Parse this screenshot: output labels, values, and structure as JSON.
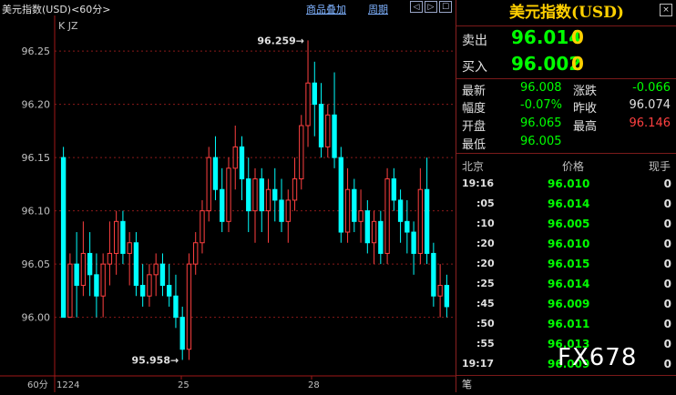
{
  "header": {
    "title": "美元指数(USD)<60分>",
    "links": [
      "商品叠加",
      "周期"
    ],
    "nav_buttons": [
      "◁",
      "▷",
      "☐"
    ]
  },
  "chart_data": {
    "type": "candlestick",
    "indicator_label": "K JZ",
    "period_label": "60分",
    "ylim": [
      95.945,
      96.28
    ],
    "y_ticks": [
      "96.25",
      "96.20",
      "96.15",
      "96.10",
      "96.05",
      "96.00"
    ],
    "x_ticks": [
      "1224",
      "25",
      "28"
    ],
    "annotations": {
      "high": "96.259",
      "low": "95.958"
    },
    "colors": {
      "up": "#ff4040",
      "down": "#00ffff"
    },
    "candles": [
      [
        96.15,
        96.16,
        96.0,
        96.0
      ],
      [
        96.0,
        96.06,
        96.0,
        96.05
      ],
      [
        96.05,
        96.08,
        96.0,
        96.03
      ],
      [
        96.03,
        96.09,
        96.02,
        96.06
      ],
      [
        96.06,
        96.08,
        96.02,
        96.04
      ],
      [
        96.04,
        96.06,
        96.0,
        96.02
      ],
      [
        96.02,
        96.06,
        96.0,
        96.05
      ],
      [
        96.05,
        96.09,
        96.03,
        96.06
      ],
      [
        96.06,
        96.1,
        96.04,
        96.09
      ],
      [
        96.09,
        96.1,
        96.05,
        96.06
      ],
      [
        96.06,
        96.08,
        96.03,
        96.07
      ],
      [
        96.07,
        96.08,
        96.02,
        96.03
      ],
      [
        96.03,
        96.05,
        96.01,
        96.02
      ],
      [
        96.02,
        96.05,
        96.01,
        96.04
      ],
      [
        96.04,
        96.06,
        96.02,
        96.05
      ],
      [
        96.05,
        96.06,
        96.02,
        96.03
      ],
      [
        96.03,
        96.05,
        96.01,
        96.02
      ],
      [
        96.02,
        96.04,
        95.99,
        96.0
      ],
      [
        96.0,
        96.01,
        95.96,
        95.97
      ],
      [
        95.97,
        96.06,
        95.96,
        96.05
      ],
      [
        96.05,
        96.08,
        96.04,
        96.07
      ],
      [
        96.07,
        96.11,
        96.06,
        96.1
      ],
      [
        96.1,
        96.16,
        96.09,
        96.15
      ],
      [
        96.15,
        96.17,
        96.11,
        96.12
      ],
      [
        96.12,
        96.14,
        96.08,
        96.09
      ],
      [
        96.09,
        96.15,
        96.08,
        96.14
      ],
      [
        96.14,
        96.18,
        96.12,
        96.16
      ],
      [
        96.16,
        96.17,
        96.11,
        96.13
      ],
      [
        96.13,
        96.15,
        96.08,
        96.1
      ],
      [
        96.1,
        96.14,
        96.07,
        96.13
      ],
      [
        96.13,
        96.14,
        96.08,
        96.1
      ],
      [
        96.1,
        96.13,
        96.07,
        96.12
      ],
      [
        96.12,
        96.14,
        96.09,
        96.11
      ],
      [
        96.11,
        96.13,
        96.08,
        96.09
      ],
      [
        96.09,
        96.12,
        96.07,
        96.11
      ],
      [
        96.11,
        96.15,
        96.1,
        96.13
      ],
      [
        96.13,
        96.19,
        96.12,
        96.18
      ],
      [
        96.18,
        96.26,
        96.16,
        96.22
      ],
      [
        96.22,
        96.24,
        96.17,
        96.2
      ],
      [
        96.2,
        96.22,
        96.15,
        96.16
      ],
      [
        96.16,
        96.2,
        96.15,
        96.19
      ],
      [
        96.19,
        96.23,
        96.14,
        96.15
      ],
      [
        96.15,
        96.16,
        96.07,
        96.08
      ],
      [
        96.08,
        96.14,
        96.07,
        96.12
      ],
      [
        96.12,
        96.13,
        96.08,
        96.09
      ],
      [
        96.09,
        96.12,
        96.07,
        96.1
      ],
      [
        96.1,
        96.11,
        96.06,
        96.07
      ],
      [
        96.07,
        96.1,
        96.05,
        96.09
      ],
      [
        96.09,
        96.1,
        96.05,
        96.06
      ],
      [
        96.06,
        96.14,
        96.05,
        96.13
      ],
      [
        96.13,
        96.14,
        96.1,
        96.11
      ],
      [
        96.11,
        96.12,
        96.07,
        96.09
      ],
      [
        96.09,
        96.11,
        96.06,
        96.08
      ],
      [
        96.08,
        96.09,
        96.04,
        96.06
      ],
      [
        96.06,
        96.14,
        96.05,
        96.12
      ],
      [
        96.12,
        96.15,
        96.05,
        96.06
      ],
      [
        96.06,
        96.07,
        96.01,
        96.02
      ],
      [
        96.02,
        96.05,
        96.0,
        96.03
      ],
      [
        96.03,
        96.04,
        96.0,
        96.01
      ]
    ]
  },
  "panel": {
    "title": "美元指数(USD)",
    "close_icon": "×",
    "sell_label": "卖出",
    "sell_price": "96.014",
    "sell_vol": "0",
    "buy_label": "买入",
    "buy_price": "96.002",
    "buy_vol": "0",
    "stats": {
      "latest_label": "最新",
      "latest": "96.008",
      "change_label": "涨跌",
      "change": "-0.066",
      "pct_label": "幅度",
      "pct": "-0.07%",
      "prev_label": "昨收",
      "prev": "96.074",
      "open_label": "开盘",
      "open": "96.065",
      "high_label": "最高",
      "high": "96.146",
      "low_label": "最低",
      "low": "96.005"
    },
    "ticks_header": {
      "time": "北京",
      "price": "价格",
      "vol": "现手"
    },
    "ticks": [
      {
        "time": "19:16",
        "price": "96.010",
        "vol": "0"
      },
      {
        "time": ":05",
        "price": "96.014",
        "vol": "0"
      },
      {
        "time": ":10",
        "price": "96.005",
        "vol": "0"
      },
      {
        "time": ":20",
        "price": "96.010",
        "vol": "0"
      },
      {
        "time": ":20",
        "price": "96.015",
        "vol": "0"
      },
      {
        "time": ":25",
        "price": "96.014",
        "vol": "0"
      },
      {
        "time": ":45",
        "price": "96.009",
        "vol": "0"
      },
      {
        "time": ":50",
        "price": "96.011",
        "vol": "0"
      },
      {
        "time": ":55",
        "price": "96.013",
        "vol": "0"
      },
      {
        "time": "19:17",
        "price": "96.009",
        "vol": "0"
      }
    ],
    "bottom_tab": "笔"
  },
  "watermark": "FX678",
  "colors": {
    "up": "#ff4040",
    "down": "#00ffff",
    "price_green": "#00ff00",
    "accent_yellow": "#ffd000"
  }
}
